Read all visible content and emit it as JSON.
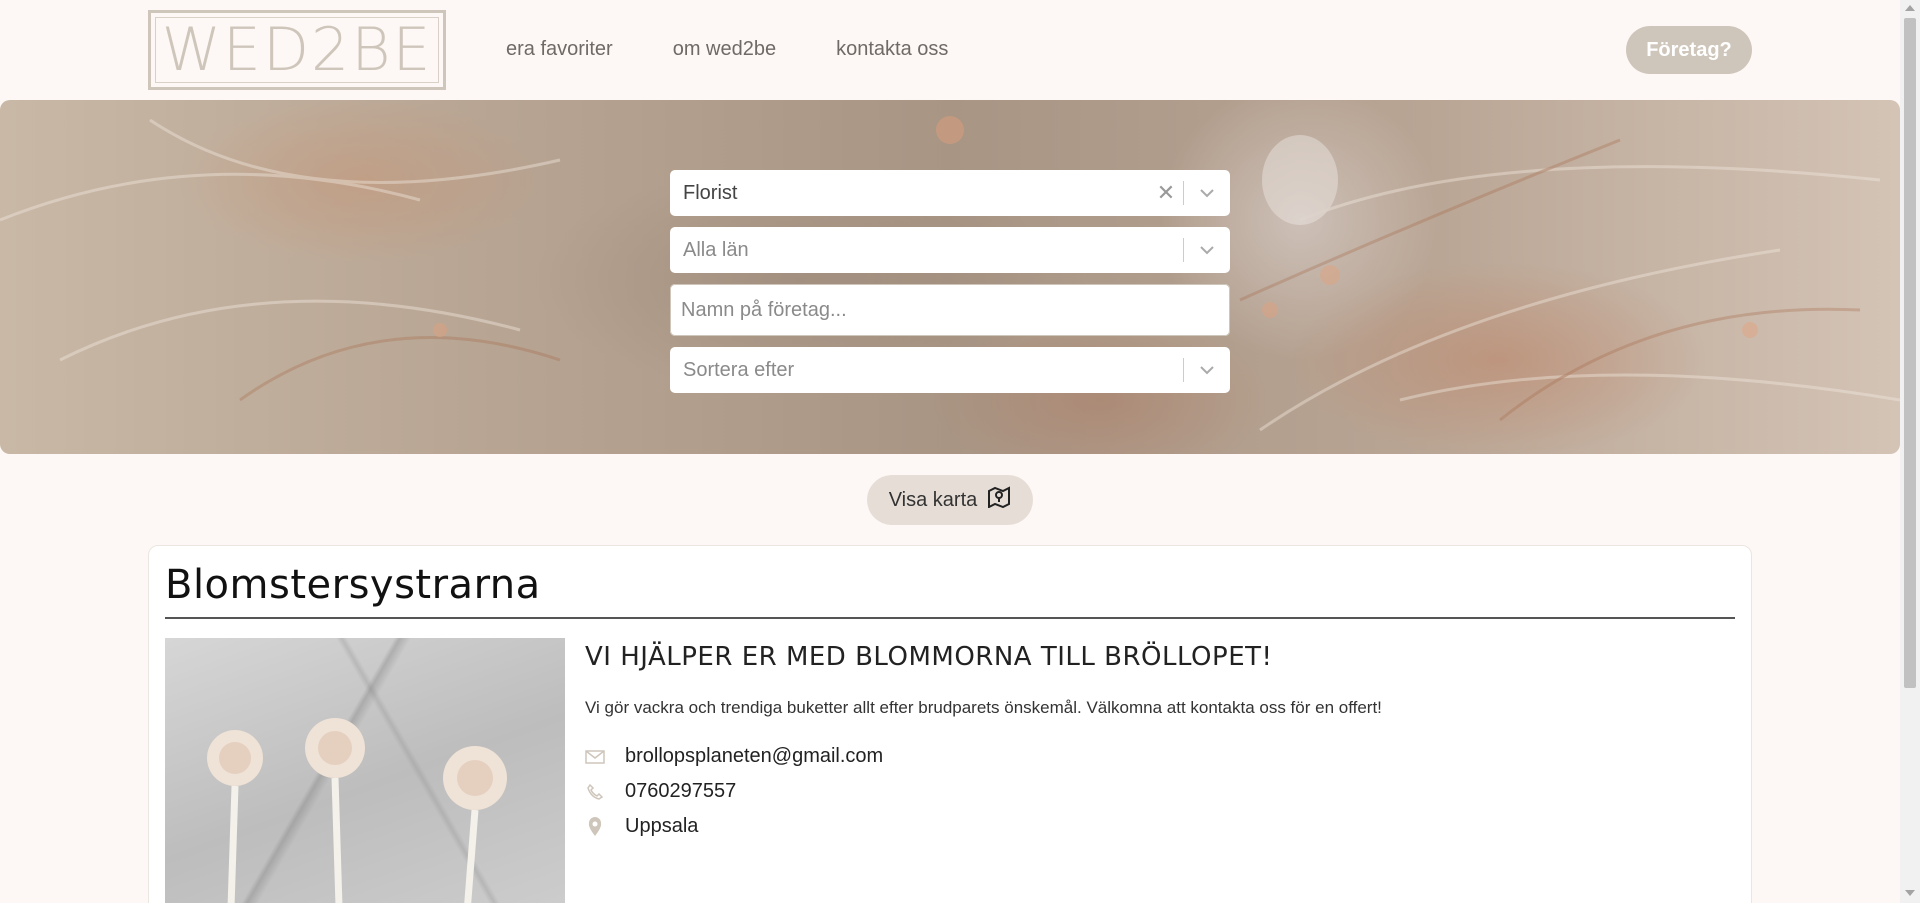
{
  "header": {
    "logo_text": "WED2BE",
    "nav": [
      {
        "label": "era favoriter"
      },
      {
        "label": "om wed2be"
      },
      {
        "label": "kontakta oss"
      }
    ],
    "business_button": "Företag?"
  },
  "search": {
    "category": {
      "value": "Florist",
      "clear_icon": "close-icon",
      "dropdown_icon": "chevron-down-icon"
    },
    "region": {
      "placeholder": "Alla län",
      "dropdown_icon": "chevron-down-icon"
    },
    "company_name": {
      "placeholder": "Namn på företag..."
    },
    "sort": {
      "placeholder": "Sortera efter",
      "dropdown_icon": "chevron-down-icon"
    }
  },
  "map_button": {
    "label": "Visa karta",
    "icon": "map-icon"
  },
  "results": [
    {
      "name": "Blomstersystrarna",
      "headline": "VI HJÄLPER ER MED BLOMMORNA TILL BRÖLLOPET!",
      "description": "Vi gör vackra och trendiga buketter allt efter brudparets önskemål. Välkomna att kontakta oss för en offert!",
      "email": "brollopsplaneten@gmail.com",
      "phone": "0760297557",
      "city": "Uppsala"
    }
  ],
  "colors": {
    "accent": "#cfc6bb",
    "background": "#fdf8f5",
    "nav_text": "#6f6a66",
    "map_button_bg": "#e6ded6"
  }
}
